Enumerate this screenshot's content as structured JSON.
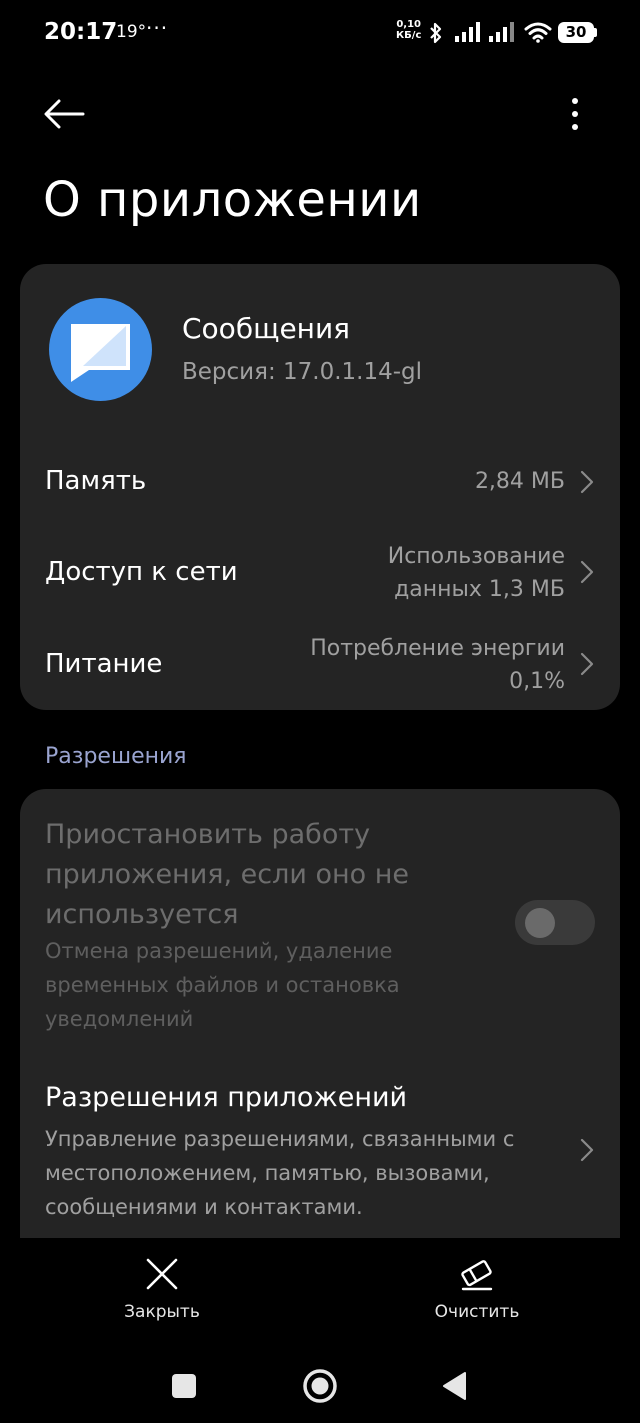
{
  "status_bar": {
    "time": "20:17",
    "temperature": "19°",
    "more_dots": "···",
    "speed_value": "0,10",
    "speed_unit": "КБ/с",
    "battery": "30"
  },
  "header": {
    "title": "О приложении"
  },
  "app_info": {
    "name": "Сообщения",
    "version": "Версия: 17.0.1.14-gl",
    "icon_color": "#3f8ee7"
  },
  "info_rows": [
    {
      "label": "Память",
      "value_line1": "2,84 МБ",
      "value_line2": ""
    },
    {
      "label": "Доступ к сети",
      "value_line1": "Использование",
      "value_line2": "данных 1,3 МБ"
    },
    {
      "label": "Питание",
      "value_line1": "Потребление энергии",
      "value_line2": "0,1%"
    }
  ],
  "permissions_section": {
    "title": "Разрешения",
    "pause_app": {
      "title": "Приостановить работу приложения, если оно не используется",
      "description": "Отмена разрешений, удаление временных файлов и остановка уведомлений",
      "enabled": false
    },
    "app_permissions": {
      "title": "Разрешения приложений",
      "description": "Управление разрешениями, связанными с местоположением, памятью, вызовами, сообщениями и контактами."
    }
  },
  "bottom_actions": {
    "close_label": "Закрыть",
    "clear_label": "Очистить"
  },
  "icons": {
    "back": "arrow-left-icon",
    "more": "more-vertical-icon",
    "chevron": "chevron-right-icon",
    "close": "close-icon",
    "clear": "eraser-icon"
  }
}
